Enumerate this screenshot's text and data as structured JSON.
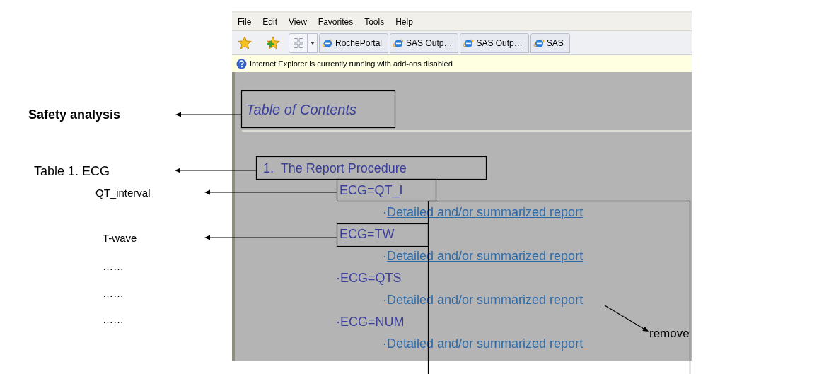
{
  "menu": [
    "File",
    "Edit",
    "View",
    "Favorites",
    "Tools",
    "Help"
  ],
  "tabs": [
    {
      "label": "RochePortal"
    },
    {
      "label": "SAS Outp…"
    },
    {
      "label": "SAS Outp…"
    },
    {
      "label": "SAS"
    }
  ],
  "info_bar": "Internet Explorer is currently running with add-ons disabled",
  "page": {
    "title": "Table of Contents",
    "section": "1.  The Report Procedure",
    "items": [
      {
        "marker": "",
        "label": "ECG=QT_I",
        "link_marker": "·",
        "link": "Detailed and/or summarized report"
      },
      {
        "marker": "",
        "label": "ECG=TW",
        "link_marker": "·",
        "link": "Detailed and/or summarized report"
      },
      {
        "marker": "·",
        "label": "ECG=QTS",
        "link_marker": "·",
        "link": "Detailed and/or summarized report"
      },
      {
        "marker": "·",
        "label": "ECG=NUM",
        "link_marker": "·",
        "link": "Detailed and/or summarized report"
      }
    ]
  },
  "annotations": {
    "labels": [
      {
        "kind": "heading",
        "text": "Safety analysis"
      },
      {
        "kind": "table",
        "text": "Table 1. ECG"
      },
      {
        "kind": "item",
        "text": "QT_interval"
      },
      {
        "kind": "item",
        "text": "T-wave"
      },
      {
        "kind": "item",
        "text": "……"
      },
      {
        "kind": "item",
        "text": "……"
      },
      {
        "kind": "item",
        "text": "……"
      }
    ],
    "remove": "remove"
  }
}
